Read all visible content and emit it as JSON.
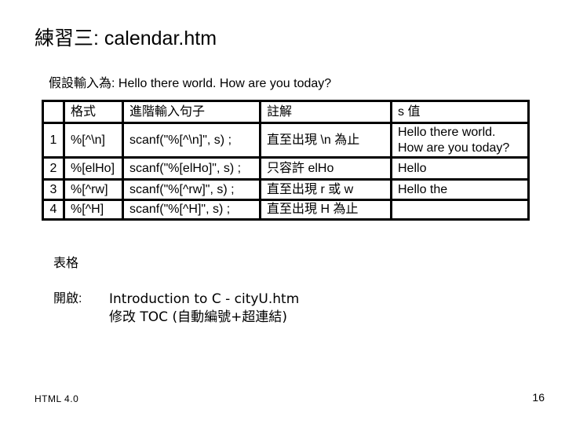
{
  "slide": {
    "title": "練習三: calendar.htm",
    "subtitle_label": "假設輸入為: ",
    "subtitle_value": "Hello there world. How are you today?"
  },
  "table": {
    "headers": [
      "",
      "格式",
      "進階輸入句子",
      "註解",
      "s 值"
    ],
    "rows": [
      {
        "num": "1",
        "format": "%[^\\n]",
        "statement": "scanf(\"%[^\\n]\", s) ;",
        "note": "直至出現 \\n 為止",
        "s_value": "Hello there world. How are you today?"
      },
      {
        "num": "2",
        "format": "%[elHo]",
        "statement": "scanf(\"%[elHo]\", s) ;",
        "note": "只容許 elHo",
        "s_value": "Hello"
      },
      {
        "num": "3",
        "format": "%[^rw]",
        "statement": "scanf(\"%[^rw]\", s) ;",
        "note": "直至出現 r 或 w",
        "s_value": "Hello the"
      },
      {
        "num": "4",
        "format": "%[^H]",
        "statement": "scanf(\"%[^H]\", s) ;",
        "note": "直至出現 H 為止",
        "s_value": ""
      }
    ]
  },
  "notes": {
    "section_label": "表格",
    "open_label": "開啟:",
    "open_line1": "Introduction to C - cityU.htm",
    "open_line2": "修改 TOC (自動編號+超連結)"
  },
  "footer": {
    "left": "HTML 4.0",
    "page_number": "16"
  }
}
